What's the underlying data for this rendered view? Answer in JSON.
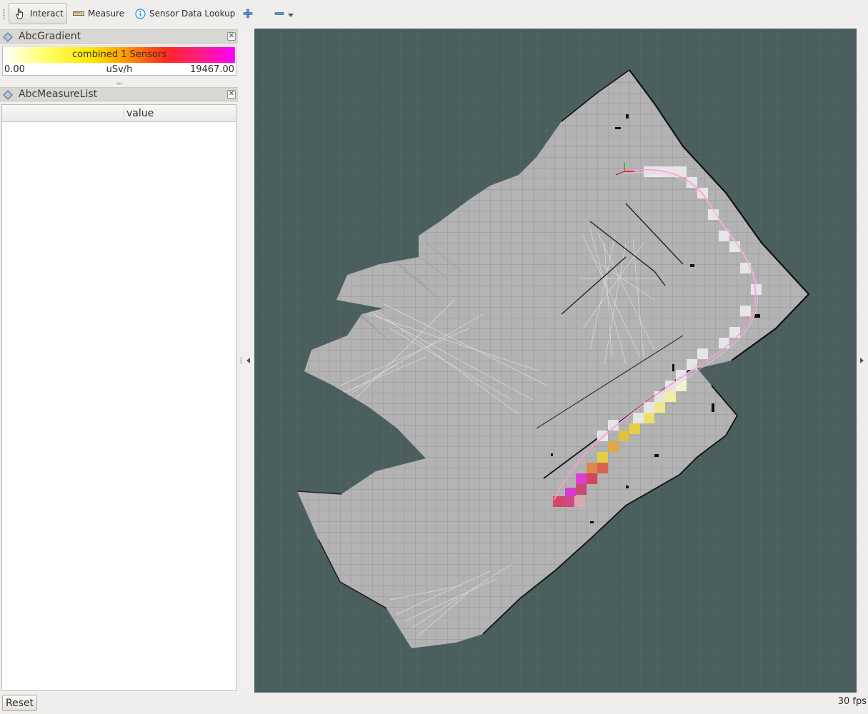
{
  "toolbar": {
    "tools": [
      {
        "label": "Interact",
        "icon": "hand-pointer-icon",
        "active": true
      },
      {
        "label": "Measure",
        "icon": "ruler-icon",
        "active": false
      },
      {
        "label": "Sensor Data Lookup",
        "icon": "info-icon",
        "active": false
      }
    ],
    "add_icon": "plus-icon",
    "remove_icon": "minus-icon",
    "dropdown_icon": "dropdown-arrow-icon"
  },
  "gradient_panel": {
    "title": "AbcGradient",
    "bar_label": "combined 1 Sensors",
    "min": "0.00",
    "unit": "uSv/h",
    "max": "19467.00",
    "colors": [
      "#ffffff",
      "#ffff66",
      "#ffe600",
      "#ff9b00",
      "#ff2a1e",
      "#ff1d7e",
      "#ff00ff"
    ]
  },
  "measure_panel": {
    "title": "AbcMeasureList",
    "columns": [
      "",
      "value"
    ],
    "rows": []
  },
  "viewport": {
    "background": "#4a5e5e",
    "map_color": "#b3b3b3",
    "path_color": "#ff9ad6"
  },
  "status": {
    "reset_label": "Reset",
    "fps": "30 fps"
  }
}
